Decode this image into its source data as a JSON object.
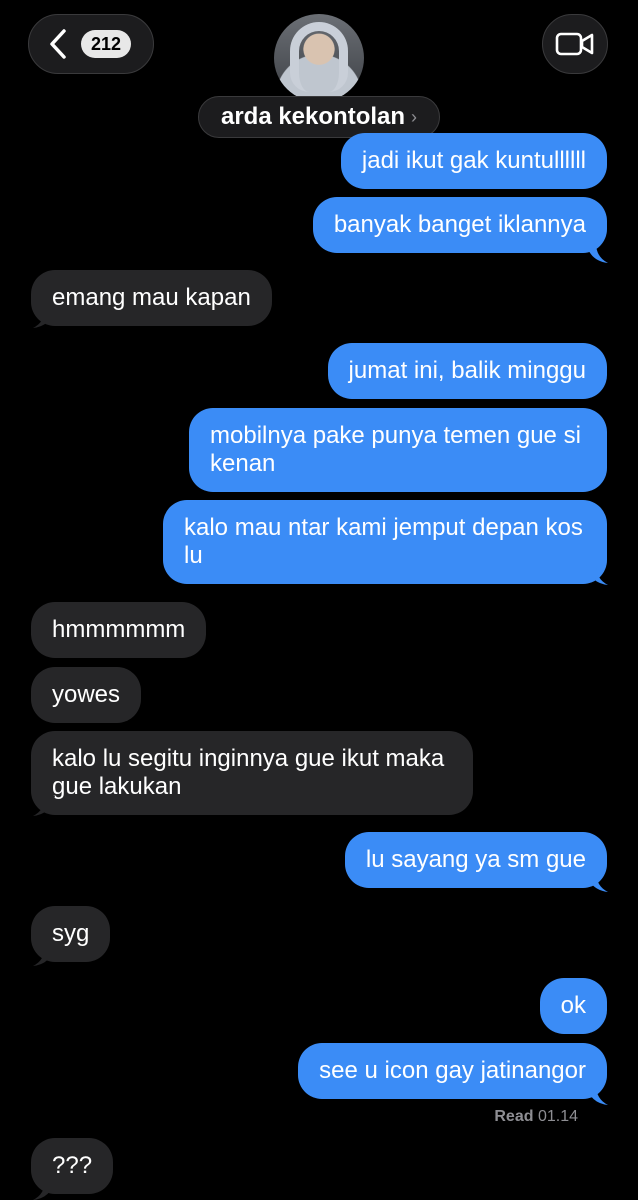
{
  "header": {
    "unread_count": "212",
    "contact_name": "arda kekontolan",
    "name_chevron": "›",
    "icons": {
      "back": "chevron-left-icon",
      "video": "video-camera-icon",
      "name_chevron": "chevron-right-icon"
    }
  },
  "messages": [
    {
      "side": "sent",
      "text": "jadi ikut gak kuntullllll"
    },
    {
      "side": "sent",
      "text": "banyak banget iklannya"
    },
    {
      "side": "recv",
      "text": "emang mau kapan"
    },
    {
      "side": "sent",
      "text": "jumat ini, balik minggu"
    },
    {
      "side": "sent",
      "text": "mobilnya pake punya temen gue si kenan"
    },
    {
      "side": "sent",
      "text": "kalo mau ntar kami jemput depan kos lu"
    },
    {
      "side": "recv",
      "text": "hmmmmmm"
    },
    {
      "side": "recv",
      "text": "yowes"
    },
    {
      "side": "recv",
      "text": "kalo lu segitu inginnya gue ikut maka gue lakukan"
    },
    {
      "side": "sent",
      "text": "lu sayang ya sm gue"
    },
    {
      "side": "recv",
      "text": "syg"
    },
    {
      "side": "sent",
      "text": "ok"
    },
    {
      "side": "sent",
      "text": "see u icon gay jatinangor"
    },
    {
      "side": "recv",
      "text": "???"
    }
  ],
  "receipt": {
    "label": "Read",
    "time": "01.14"
  },
  "colors": {
    "sent_bubble": "#3b8cf6",
    "recv_bubble": "#262628",
    "background": "#000000"
  }
}
